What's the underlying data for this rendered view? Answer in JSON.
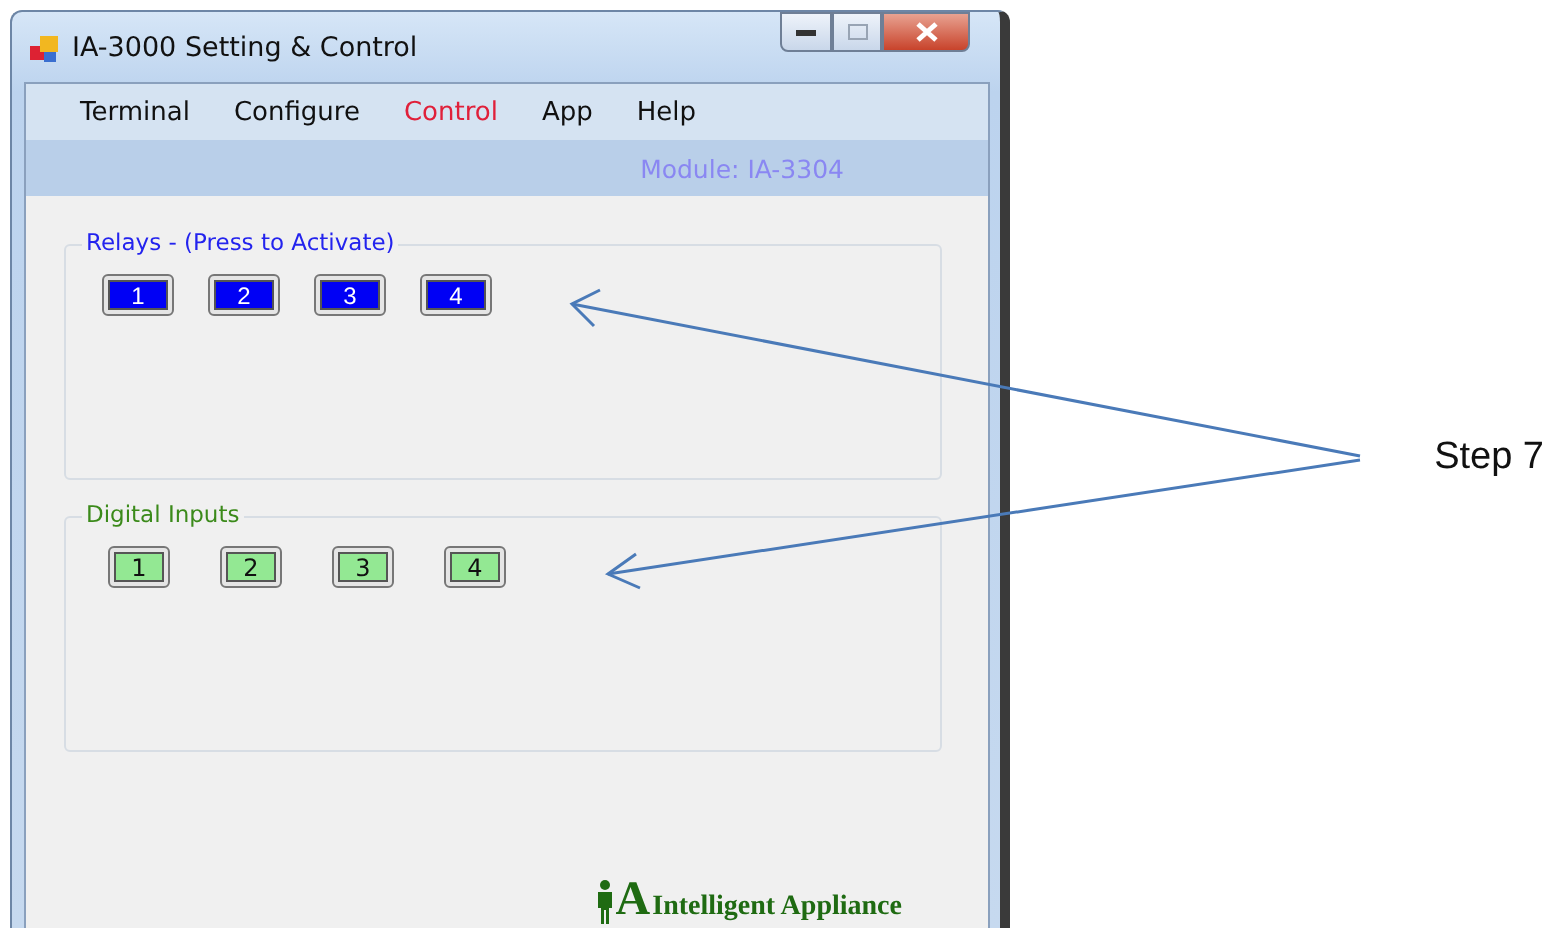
{
  "window": {
    "title": "IA-3000 Setting & Control"
  },
  "menu": [
    {
      "label": "Terminal",
      "selected": false
    },
    {
      "label": "Configure",
      "selected": false
    },
    {
      "label": "Control",
      "selected": true
    },
    {
      "label": "App",
      "selected": false
    },
    {
      "label": "Help",
      "selected": false
    }
  ],
  "module": "Module: IA-3304",
  "groups": [
    {
      "kind": "relay",
      "title": "Relays - (Press to Activate)",
      "buttons": [
        "1",
        "2",
        "3",
        "4"
      ]
    },
    {
      "kind": "input",
      "title": "Digital Inputs",
      "buttons": [
        "1",
        "2",
        "3",
        "4"
      ]
    }
  ],
  "logo": {
    "mark": "A",
    "text": "Intelligent Appliance"
  },
  "annotation": "Step 7"
}
